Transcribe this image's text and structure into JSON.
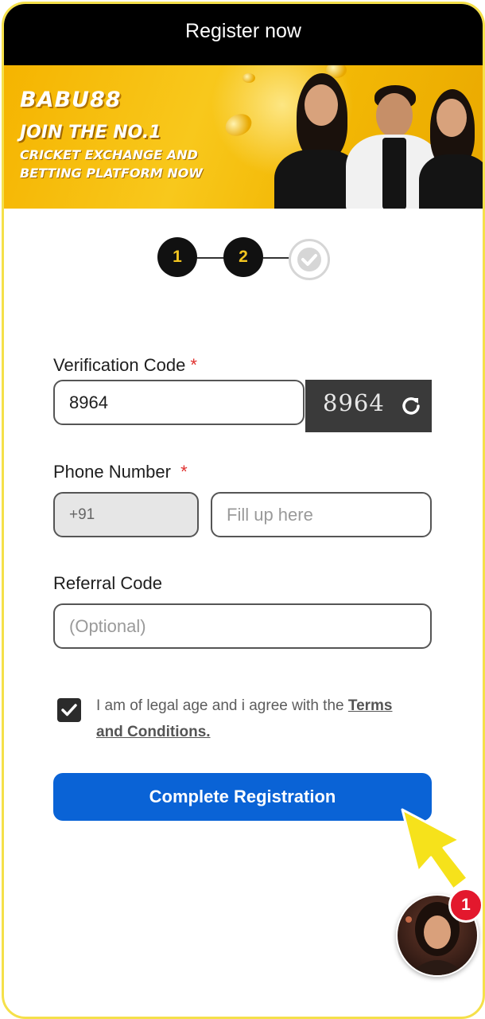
{
  "header": {
    "title": "Register now"
  },
  "banner": {
    "logo": "BABU88",
    "tagline_1": "JOIN THE NO.1",
    "tagline_2": "CRICKET EXCHANGE AND",
    "tagline_3": "BETTING PLATFORM NOW"
  },
  "stepper": {
    "steps": [
      "1",
      "2"
    ],
    "current_step": 2,
    "total_steps": 3
  },
  "form": {
    "verification": {
      "label": "Verification Code",
      "required_mark": "*",
      "value": "8964",
      "captcha_text": "8964"
    },
    "phone": {
      "label": "Phone Number",
      "required_mark": "*",
      "country_code": "+91",
      "placeholder": "Fill up here",
      "value": ""
    },
    "referral": {
      "label": "Referral Code",
      "placeholder": "(Optional)",
      "value": ""
    },
    "agreement": {
      "checked": true,
      "text": "I am of legal age and i agree with the ",
      "link_text": "Terms and Conditions."
    },
    "submit_label": "Complete Registration"
  },
  "chat": {
    "badge_count": "1"
  },
  "colors": {
    "accent_yellow": "#f5e04a",
    "primary_blue": "#0a63d6",
    "step_active_text": "#f3c520",
    "required_red": "#e0302e",
    "badge_red": "#e3182d"
  }
}
